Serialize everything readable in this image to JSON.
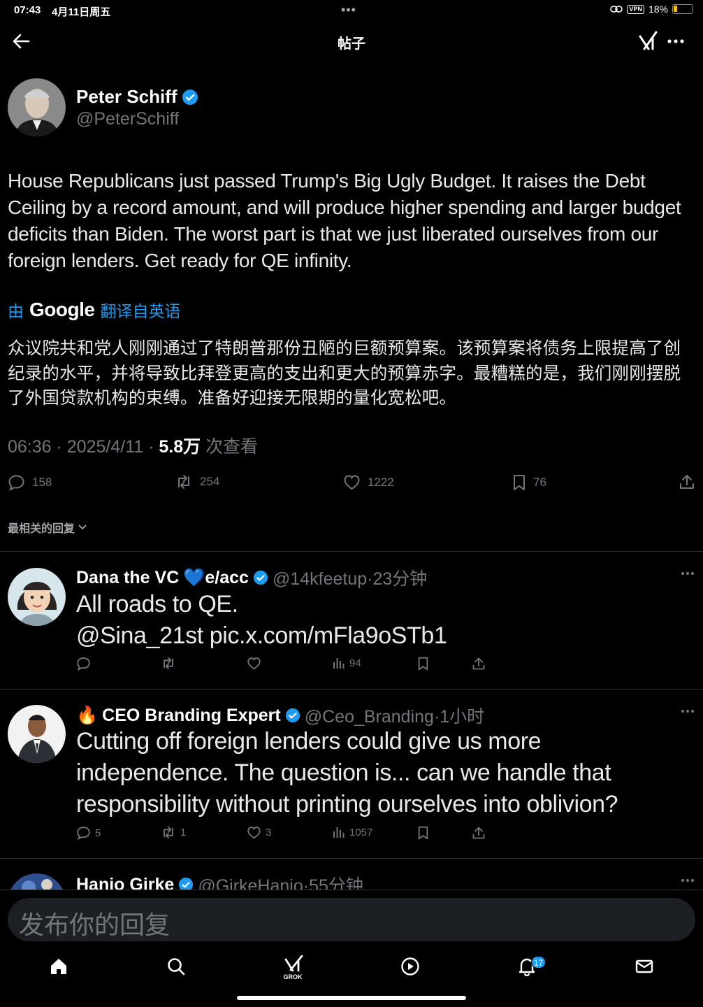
{
  "status_bar": {
    "time": "07:43",
    "date": "4月11日周五",
    "vpn": "VPN",
    "battery": "18%"
  },
  "header": {
    "title": "帖子"
  },
  "post": {
    "author_name": "Peter Schiff",
    "author_handle": "@PeterSchiff",
    "text": "House Republicans just passed Trump's Big Ugly Budget. It raises the Debt Ceiling by a record amount, and will produce higher spending and larger budget deficits than Biden. The worst part is that we just liberated ourselves from our foreign lenders. Get ready for QE infinity.",
    "translate_prefix": "由",
    "translate_brand": "Google",
    "translate_label": "翻译自英语",
    "translation": "众议院共和党人刚刚通过了特朗普那份丑陋的巨额预算案。该预算案将债务上限提高了创纪录的水平，并将导致比拜登更高的支出和更大的预算赤字。最糟糕的是，我们刚刚摆脱了外国贷款机构的束缚。准备好迎接无限期的量化宽松吧。",
    "time": "06:36 · 2025/4/11 · ",
    "views": "5.8万",
    "views_label": " 次查看",
    "replies": "158",
    "reposts": "254",
    "likes": "1222",
    "bookmarks": "76"
  },
  "sort_label": "最相关的回复",
  "replies": [
    {
      "name": "Dana the VC",
      "name_suffix": "💙e/acc",
      "handle_time": "@14kfeetup·23分钟",
      "text": "All roads to QE.",
      "link": "@Sina_21st pic.x.com/mFla9oSTb1",
      "views": "94"
    },
    {
      "name_prefix": "🔥",
      "name": "CEO Branding Expert",
      "handle_time": "@Ceo_Branding·1小时",
      "text": "Cutting off foreign lenders could give us more independence. The question is... can we handle that responsibility without printing ourselves into oblivion?",
      "replies": "5",
      "reposts": "1",
      "likes": "3",
      "views": "1057"
    },
    {
      "name": "Hanjo Girke",
      "handle_time": "@GirkeHanjo·55分钟"
    }
  ],
  "compose": {
    "placeholder": "发布你的回复"
  },
  "tabbar": {
    "grok_label": "GROK",
    "notification_count": "17"
  },
  "colors": {
    "accent": "#1d9bf0",
    "background": "#000000",
    "muted": "#71767b",
    "battery": "#f5c400"
  }
}
